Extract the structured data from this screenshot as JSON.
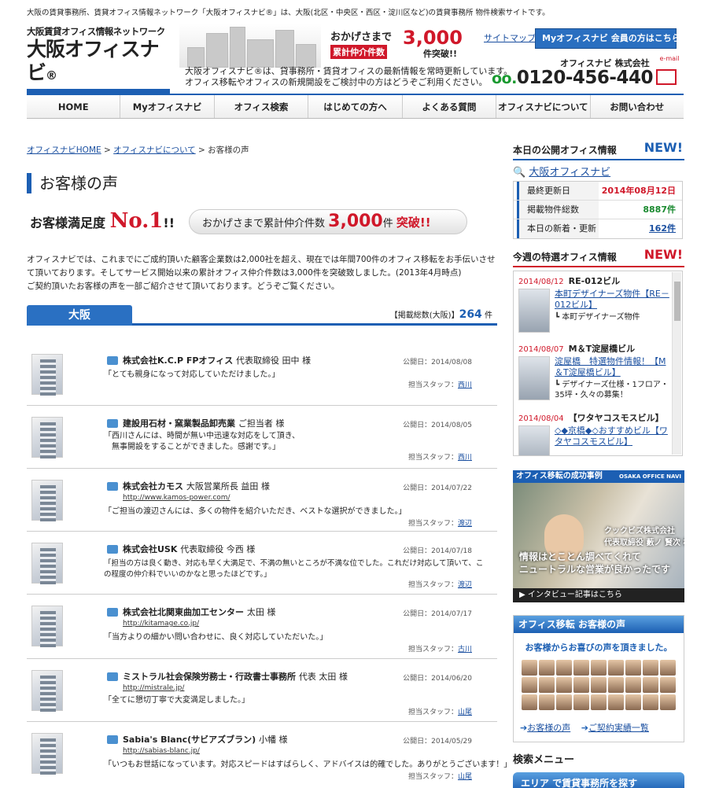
{
  "header": {
    "topline": "大阪の賃貸事務所、賃貸オフィス情報ネットワーク「大阪オフィスナビ®」は、大阪(北区・中央区・西区・淀川区など)の賃貸事務所 物件検索サイトです。",
    "logo_small": "大阪賃貸オフィス情報ネットワーク",
    "logo_main": "大阪オフィスナビ",
    "logo_reg": "®",
    "logo_en": "OSAKA OFFICE NAVI",
    "catch_1": "おかげさまで",
    "catch_2": "累計仲介件数",
    "catch_num": "3,000",
    "catch_3": "件突破!!",
    "intro_1": "大阪オフィスナビ®は、貸事務所・賃貸オフィスの最新情報を常時更新しています。",
    "intro_2": "オフィス移転やオフィスの新規開設をご検討中の方はどうぞご利用ください。",
    "sitemap": "サイトマップ",
    "my_button": "Myオフィスナビ 会員の方はこちら",
    "company": "オフィスナビ 株式会社",
    "email": "e-mail",
    "phone_prefix": "0120",
    "phone": "0120-456-440"
  },
  "nav": [
    "HOME",
    "Myオフィスナビ",
    "オフィス検索",
    "はじめての方へ",
    "よくある質問",
    "オフィスナビについて",
    "お問い合わせ"
  ],
  "breadcrumb": {
    "home": "オフィスナビHOME",
    "about": "オフィスナビについて",
    "current": "お客様の声",
    "sep": ">"
  },
  "page": {
    "title": "お客様の声",
    "sat_label": "お客様満足度",
    "sat_no1": "No.1",
    "sat_mark": "!!",
    "pill_text": "おかげさまで累計仲介件数",
    "pill_num": "3,000",
    "pill_unit": "件",
    "pill_break": "突破!!",
    "desc_1": "オフィスナビでは、これまでにご成約頂いた顧客企業数は2,000社を超え、現在では年間700件のオフィス移転をお手伝いさせて頂いております。そしてサービス開始以来の累計オフィス仲介件数は3,000件を突破致しました。(2013年4月時点)",
    "desc_2": "ご契約頂いたお客様の声を一部ご紹介させて頂いております。どうぞご覧ください。",
    "tab": "大阪",
    "count_label": "【掲載総数(大阪)】",
    "count_num": "264",
    "count_unit": "件"
  },
  "entries": [
    {
      "name": "株式会社K.C.P FPオフィス",
      "role": "代表取締役 田中 様",
      "url": "",
      "date": "公開日：2014/08/08",
      "comment": "「とても親身になって対応していただけました。」",
      "comment2": "",
      "staff_label": "担当スタッフ：",
      "staff": "西川"
    },
    {
      "name": "建設用石材・窯業製品卸売業",
      "role": "ご担当者 様",
      "url": "",
      "date": "公開日：2014/08/05",
      "comment": "「西川さんには、時間が無い中迅速な対応をして頂き、",
      "comment2": "　無事開設をすることができました。感謝です。」",
      "staff_label": "担当スタッフ：",
      "staff": "西川"
    },
    {
      "name": "株式会社カモス",
      "role": "大阪営業所長 益田 様",
      "url": "http://www.kamos-power.com/",
      "date": "公開日：2014/07/22",
      "comment": "「ご担当の渡辺さんには、多くの物件を紹介いただき、ベストな選択ができました。」",
      "comment2": "",
      "staff_label": "担当スタッフ：",
      "staff": "渡辺"
    },
    {
      "name": "株式会社USK",
      "role": "代表取締役 今西 様",
      "url": "",
      "date": "公開日：2014/07/18",
      "comment": "「担当の方は良く動き、対応も早く大満足で、不満の無いところが不満な位でした。これだけ対応して頂いて、こ",
      "comment2": "の程度の仲介料でいいのかなと思ったほどです。」",
      "staff_label": "担当スタッフ：",
      "staff": "渡辺"
    },
    {
      "name": "株式会社北関東曲加工センター",
      "role": "太田 様",
      "url": "http://kitamage.co.jp/",
      "date": "公開日：2014/07/17",
      "comment": "「当方よりの細かい問い合わせに、良く対応していただいた。」",
      "comment2": "",
      "staff_label": "担当スタッフ：",
      "staff": "古川"
    },
    {
      "name": "ミストラル社会保険労務士・行政書士事務所",
      "role": "代表 太田 様",
      "url": "http://mistrale.jp/",
      "date": "公開日：2014/06/20",
      "comment": "「全てに懇切丁寧で大変満足しました。」",
      "comment2": "",
      "staff_label": "担当スタッフ：",
      "staff": "山尾"
    },
    {
      "name": "Sabia's Blanc(サビアズブラン)",
      "role": "小幡 様",
      "url": "http://sabias-blanc.jp/",
      "date": "公開日：2014/05/29",
      "comment": "「いつもお世話になっています。対応スピードはすばらしく、アドバイスは的確でした。ありがとうございます！」",
      "comment2": "",
      "staff_label": "担当スタッフ：",
      "staff": "山尾"
    }
  ],
  "sidebar": {
    "today_title": "本日の公開オフィス情報",
    "new": "NEW!",
    "site_name": "大阪オフィスナビ",
    "stats": [
      {
        "k": "最終更新日",
        "v": "2014年08月12日"
      },
      {
        "k": "掲載物件総数",
        "v": "8887件"
      },
      {
        "k": "本日の新着・更新",
        "v": "162件"
      }
    ],
    "feature_title": "今週の特選オフィス情報",
    "features": [
      {
        "date": "2014/08/12",
        "bldg": "RE-012ビル",
        "title": "本町デザイナーズ物件【RE－012ビル】",
        "sub": "┗ 本町デザイナーズ物件"
      },
      {
        "date": "2014/08/07",
        "bldg": "M＆T淀屋橋ビル",
        "title": "淀屋橋　特選物件情報！【M＆T淀屋橋ビル】",
        "sub": "┗ デザイナーズ仕様・1フロア・35坪・久々の募集！"
      },
      {
        "date": "2014/08/04",
        "bldg": "【ワタヤコスモスビル】",
        "title": "◇◆京橋◆◇おすすめビル【ワタヤコスモスビル】",
        "sub": ""
      }
    ],
    "interview_head": "オフィス移転の成功事例",
    "interview_brand": "OSAKA OFFICE NAVI",
    "interview_company": "クックビズ株式会社",
    "interview_person": "代表取締役 藪ノ 賢次 様",
    "interview_text_1": "情報はとことん調べてくれて",
    "interview_text_2": "ニュートラルな営業が良かったです",
    "interview_link": "インタビュー記事はこちら",
    "voice_head": "オフィス移転 お客様の声",
    "voice_sub": "お客様からお喜びの声を頂きました。",
    "voice_link1": "お客様の声",
    "voice_link2": "ご契約実績一覧",
    "search_menu": "検索メニュー",
    "area_head": "エリア で賃貸事務所を探す"
  }
}
